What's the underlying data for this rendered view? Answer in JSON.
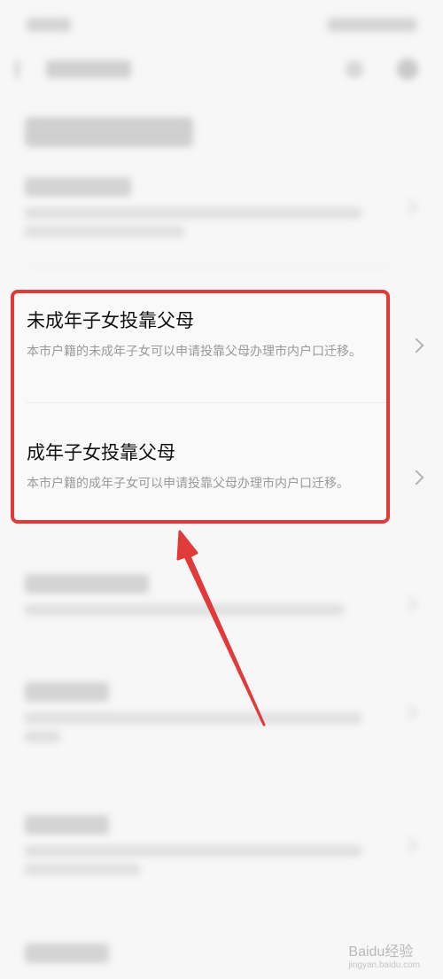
{
  "highlighted_card": {
    "items": [
      {
        "title": "未成年子女投靠父母",
        "description": "本市户籍的未成年子女可以申请投靠父母办理市内户口迁移。"
      },
      {
        "title": "成年子女投靠父母",
        "description": "本市户籍的成年子女可以申请投靠父母办理市内户口迁移。"
      }
    ],
    "border_color": "#e13a3a"
  },
  "annotation": {
    "arrow_color": "#e13a3a"
  },
  "watermark": {
    "brand": "Baidu经验",
    "url": "jingyan.baidu.com"
  },
  "icons": [
    "back-arrow-icon",
    "chevron-right-icon"
  ]
}
